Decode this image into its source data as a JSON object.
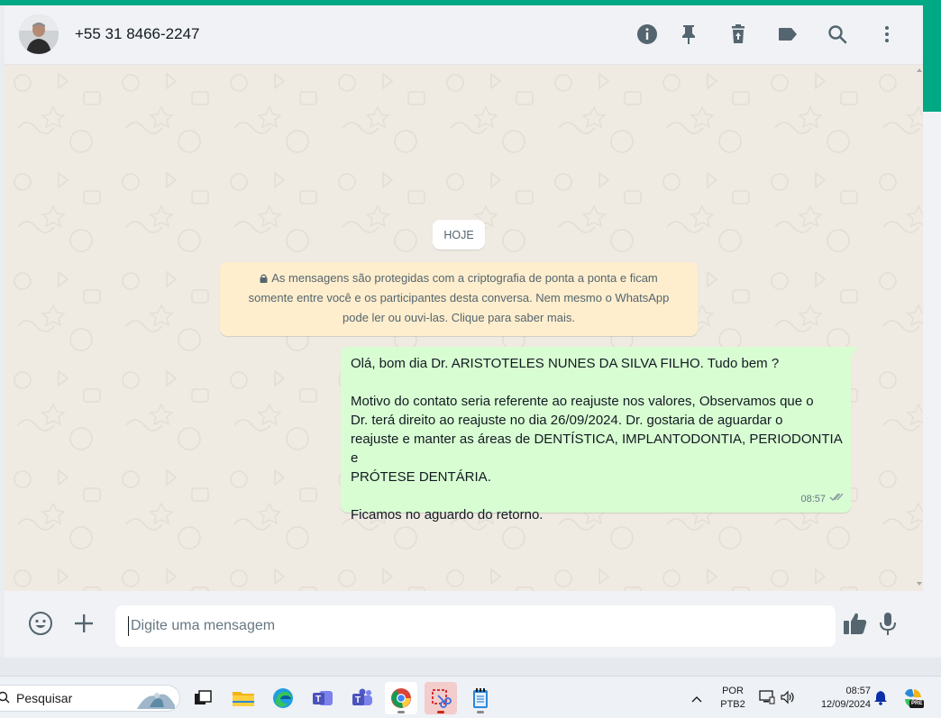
{
  "header": {
    "contact_name": "+55 31 8466-2247",
    "icons": [
      "info-icon",
      "pin-icon",
      "delete-icon",
      "label-icon",
      "search-icon",
      "more-vertical-icon"
    ]
  },
  "chat": {
    "date_chip": "HOJE",
    "encryption_notice": {
      "line1": "As mensagens são protegidas com a criptografia de ponta a ponta e ficam",
      "line2": "somente entre você e os participantes desta conversa. Nem mesmo o WhatsApp",
      "line3": "pode ler ou ouvi-las. Clique para saber mais."
    },
    "message": {
      "lines": [
        "Olá, bom dia Dr. ARISTOTELES NUNES DA SILVA FILHO. Tudo bem ?",
        "",
        "Motivo do contato seria referente ao reajuste nos valores, Observamos que o",
        "Dr. terá direito ao reajuste no dia 26/09/2024. Dr. gostaria de aguardar o",
        "reajuste e manter as áreas de DENTÍSTICA, IMPLANTODONTIA, PERIODONTIA e",
        "PRÓTESE DENTÁRIA.",
        "",
        "Ficamos no aguardo do retorno."
      ],
      "time": "08:57",
      "status": "double-check-icon"
    }
  },
  "composer": {
    "placeholder": "Digite uma mensagem",
    "icons": [
      "emoji-icon",
      "plus-icon",
      "thumbs-up-icon",
      "microphone-icon"
    ]
  },
  "taskbar": {
    "search_placeholder": "Pesquisar",
    "language_line1": "POR",
    "language_line2": "PTB2",
    "time": "08:57",
    "date": "12/09/2024",
    "copilot_badge": "PRE",
    "apps": [
      "task-view-icon",
      "file-explorer-icon",
      "edge-icon",
      "teams-classic-icon",
      "teams-icon",
      "chrome-icon",
      "snipping-tool-icon",
      "notepad-icon"
    ]
  },
  "colors": {
    "accent": "#00a884",
    "bubble_out": "#d9fdd3",
    "notice_bg": "#ffeecd",
    "chat_bg": "#efeae2",
    "panel_bg": "#f0f2f5"
  }
}
